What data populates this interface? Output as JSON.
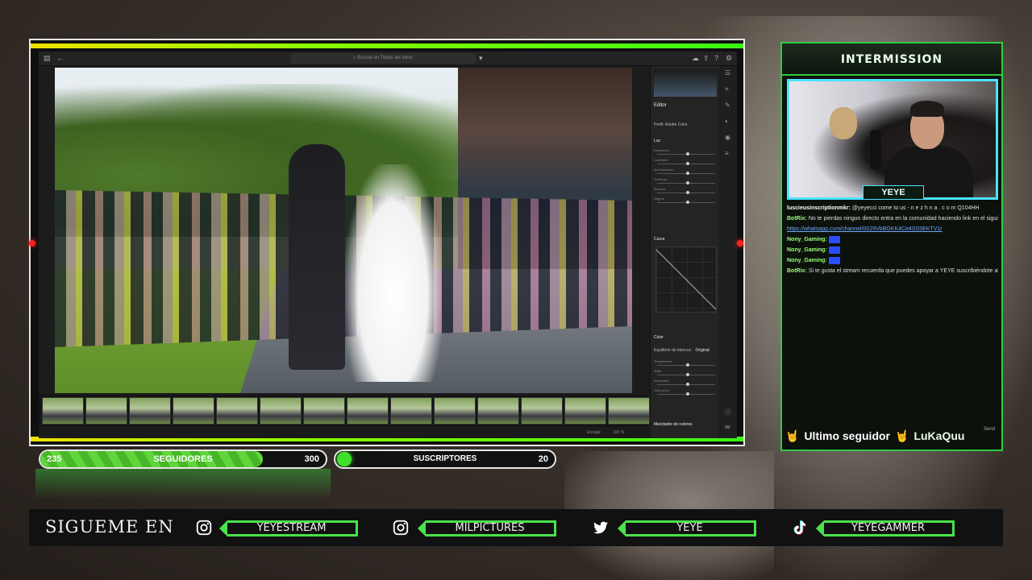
{
  "lightroom": {
    "search_placeholder": "Buscar en Todas las fotos",
    "panel_editor": "Editor",
    "panel_profile": "Perfil: Adobe Color",
    "panel_light": "Luz",
    "panel_curve": "Curva",
    "panel_color": "Color",
    "panel_mixer": "Mezclador de colores",
    "panel_balance_label": "Equilibrio de blancos",
    "panel_balance_value": "Original",
    "status_fit": "Encajar",
    "status_zoom": "100 %",
    "light_sliders": [
      "Exposición",
      "Contraste",
      "Iluminaciones",
      "Sombras",
      "Blancos",
      "Negros"
    ],
    "color_sliders": [
      "Temperatura",
      "Matiz",
      "Intensidad",
      "Saturación"
    ]
  },
  "stats": {
    "followers": {
      "current": "235",
      "label": "SEGUIDORES",
      "goal": "300",
      "progress": 0.78
    },
    "subscribers": {
      "label": "SUSCRIPTORES",
      "goal": "20",
      "progress": 0.0
    }
  },
  "side": {
    "title": "INTERMISSION",
    "cam_name": "YEYE",
    "chat": [
      {
        "user": "luscieusinscriptionmkr:",
        "text": "@yeyecci come to us - n e z h n a . c o m Q104HH",
        "color": "#ffffff"
      },
      {
        "user": "BotRix:",
        "text": "No te pierdas ningun directo entra en la comunidad haciendo link en el siguiente link",
        "color": "#9cff7a"
      },
      {
        "user": "",
        "text": "https://whatsapp.com/channel/0029VbBGKK4Ce4SS5EKTV1r",
        "color": "",
        "link": true
      },
      {
        "user": "Nony_Gaming:",
        "text": "",
        "color": "#9cff7a",
        "emote": true
      },
      {
        "user": "Nony_Gaming:",
        "text": "",
        "color": "#9cff7a",
        "emote": true
      },
      {
        "user": "Nony_Gaming:",
        "text": "",
        "color": "#9cff7a",
        "emote": true
      },
      {
        "user": "BotRix:",
        "text": "Si te gusta el stream recuerda que puedes apoyar a YEYE suscribiéndote al canal",
        "color": "#9cff7a"
      }
    ],
    "follow_label": "Ultimo seguidor",
    "follow_user": "LuKaQuu",
    "send": "Send"
  },
  "social": {
    "heading": "SIGUEME EN",
    "items": [
      {
        "icon": "instagram-icon",
        "handle": "YEYESTREAM"
      },
      {
        "icon": "instagram-icon",
        "handle": "MILPICTURES"
      },
      {
        "icon": "twitter-icon",
        "handle": "YEYE"
      },
      {
        "icon": "tiktok-icon",
        "handle": "YEYEGAMMER"
      }
    ]
  },
  "colors": {
    "accent": "#49e34a",
    "cam_border": "#4be3ff",
    "alert_red": "#ff2020"
  }
}
